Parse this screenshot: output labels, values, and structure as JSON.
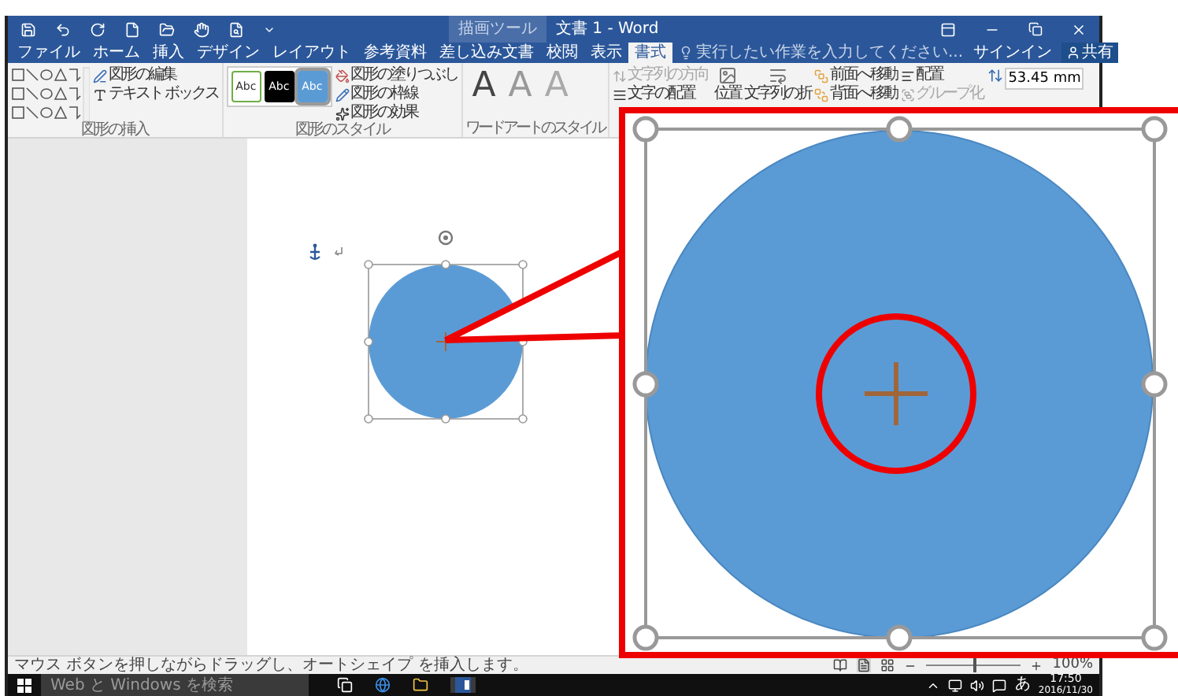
{
  "title_bar": {
    "context_group": "描画ツール",
    "title": "文書 1 - Word"
  },
  "tabs": [
    {
      "label": "ファイル",
      "selected": false
    },
    {
      "label": "ホーム",
      "selected": false
    },
    {
      "label": "挿入",
      "selected": false
    },
    {
      "label": "デザイン",
      "selected": false
    },
    {
      "label": "レイアウト",
      "selected": false
    },
    {
      "label": "参考資料",
      "selected": false
    },
    {
      "label": "差し込み文書",
      "selected": false
    },
    {
      "label": "校閲",
      "selected": false
    },
    {
      "label": "表示",
      "selected": false
    },
    {
      "label": "書式",
      "selected": true
    }
  ],
  "tell_me": {
    "placeholder": "実行したい作業を入力してください..."
  },
  "account": {
    "sign_in": "サインイン",
    "share": "共有"
  },
  "ribbon": {
    "insert_shapes": {
      "buttons": [
        "図形の編集",
        "テキスト ボックス"
      ],
      "label": "図形の挿入"
    },
    "shape_styles": {
      "presets": [
        {
          "label": "Abc",
          "kind": "outline",
          "selected": false
        },
        {
          "label": "Abc",
          "kind": "dark",
          "selected": false
        },
        {
          "label": "Abc",
          "kind": "blue",
          "selected": true
        }
      ],
      "buttons": [
        "図形の塗りつぶし",
        "図形の枠線",
        "図形の効果"
      ],
      "label": "図形のスタイル"
    },
    "wordart": {
      "letters": [
        "A",
        "A",
        "A"
      ],
      "label": "ワードアートのスタイル"
    },
    "text": {
      "buttons": [
        {
          "label": "文字列の方向",
          "disabled": true
        },
        {
          "label": "文字の配置",
          "disabled": false
        }
      ]
    },
    "arrange": {
      "large_buttons": [
        "位置",
        "文字列の折"
      ],
      "buttons": [
        {
          "label": "前面へ移動",
          "disabled": false
        },
        {
          "label": "背面へ移動",
          "disabled": false
        },
        {
          "label": "配置",
          "disabled": false
        },
        {
          "label": "グループ化",
          "disabled": true
        }
      ]
    },
    "size": {
      "height": "53.45 mm"
    }
  },
  "status_bar": {
    "message": "マウス ボタンを押しながらドラッグし、オートシェイプ を挿入します。",
    "zoom_slider": {
      "level": 0.5
    },
    "zoom": "100%"
  },
  "taskbar": {
    "search_placeholder": "Web と Windows を検索",
    "ime": "あ",
    "time": "17:50",
    "date": "2016/11/30"
  }
}
